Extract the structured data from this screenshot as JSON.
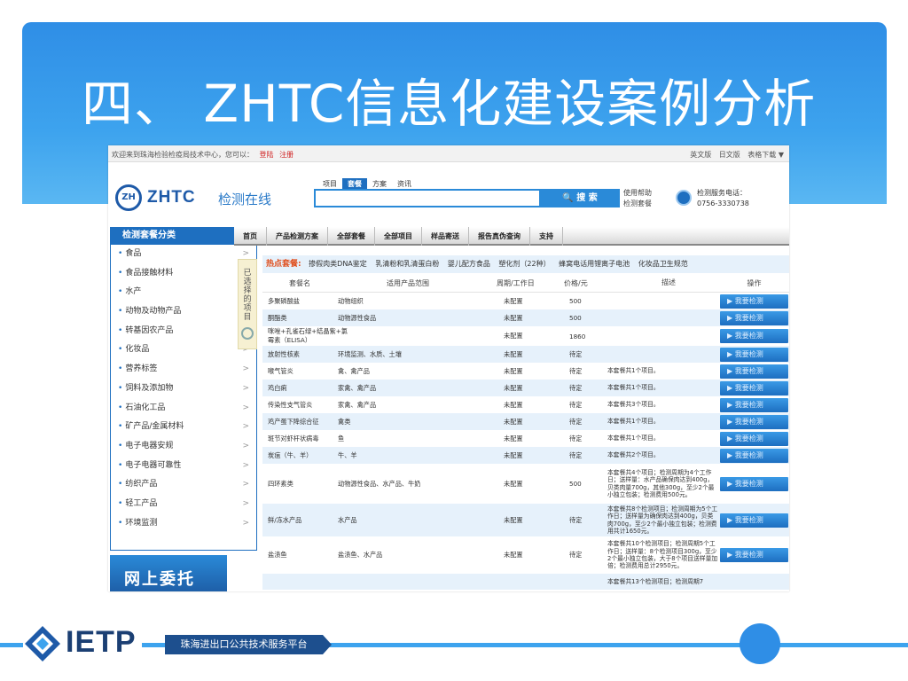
{
  "slide": {
    "title": "四、 ZHTC信息化建设案例分析",
    "footer_logo": "IETP",
    "footer_platform": "珠海进出口公共技术服务平台"
  },
  "colors": {
    "primary": "#2f8ee6",
    "brand_dark": "#1b3f73",
    "button": "#1d6ec0",
    "hot": "#e0501f"
  },
  "site": {
    "topbar": {
      "welcome": "欢迎来到珠海检验检疫局技术中心，您可以：",
      "login": "登陆",
      "register": "注册",
      "right_links": [
        "英文版",
        "日文版",
        "表格下载 ▼"
      ]
    },
    "logo": {
      "mark": "ZH",
      "name": "ZHTC",
      "sub": "检测在线"
    },
    "search": {
      "tabs": [
        "项目",
        "套餐",
        "方案",
        "资讯"
      ],
      "button": "🔍 搜 索",
      "help_1": "使用帮助",
      "help_2": "检测套餐"
    },
    "hotline": {
      "label": "检测服务电话：",
      "number": "0756-3330738"
    },
    "sidebar": {
      "title": "检测套餐分类",
      "items": [
        "食品",
        "食品接触材料",
        "水产",
        "动物及动物产品",
        "转基因农产品",
        "化妆品",
        "营养标签",
        "饲料及添加物",
        "石油化工品",
        "矿产品/金属材料",
        "电子电器安规",
        "电子电器可靠性",
        "纺织产品",
        "轻工产品",
        "环境监测"
      ],
      "arrow": ">"
    },
    "promo": "网上委托",
    "nav": [
      "首页",
      "产品检测方案",
      "全部套餐",
      "全部项目",
      "样品寄送",
      "报告真伪查询",
      "支持"
    ],
    "selected_strip": "已选择的项目",
    "hot": {
      "label": "热点套餐:",
      "tags": [
        "掺假肉类DNA鉴定",
        "乳清粉和乳清蛋白粉",
        "婴儿配方食品",
        "塑化剂（22种）",
        "蜂窝电话用锂离子电池",
        "化妆品卫生规范"
      ]
    },
    "table": {
      "headers": [
        "套餐名",
        "适用产品范围",
        "周期/工作日",
        "价格/元",
        "描述",
        "操作"
      ],
      "button_label": "▶ 我要检测",
      "rows": [
        {
          "name": "多聚磷酸盐",
          "range": "动物组织",
          "cycle": "未配置",
          "price": "500",
          "desc": ""
        },
        {
          "name": "酮酯类",
          "range": "动物源性食品",
          "cycle": "未配置",
          "price": "500",
          "desc": ""
        },
        {
          "name": "咪唑+孔雀石绿+结晶紫+氯霉素（ELISA）",
          "range": "",
          "cycle": "未配置",
          "price": "1860",
          "desc": ""
        },
        {
          "name": "放射性核素",
          "range": "环境监测、水质、土壤",
          "cycle": "未配置",
          "price": "待定",
          "desc": ""
        },
        {
          "name": "喉气管炎",
          "range": "禽、禽产品",
          "cycle": "未配置",
          "price": "待定",
          "desc": "本套餐共1个项目。"
        },
        {
          "name": "鸡白痢",
          "range": "家禽、禽产品",
          "cycle": "未配置",
          "price": "待定",
          "desc": "本套餐共1个项目。"
        },
        {
          "name": "传染性支气管炎",
          "range": "家禽、禽产品",
          "cycle": "未配置",
          "price": "待定",
          "desc": "本套餐共3个项目。"
        },
        {
          "name": "鸡产蛋下降综合征",
          "range": "禽类",
          "cycle": "未配置",
          "price": "待定",
          "desc": "本套餐共1个项目。"
        },
        {
          "name": "斑节对虾杆状病毒",
          "range": "鱼",
          "cycle": "未配置",
          "price": "待定",
          "desc": "本套餐共1个项目。"
        },
        {
          "name": "炭疽（牛、羊）",
          "range": "牛、羊",
          "cycle": "未配置",
          "price": "待定",
          "desc": "本套餐共2个项目。"
        },
        {
          "name": "四环素类",
          "range": "动物源性食品、水产品、牛奶",
          "cycle": "未配置",
          "price": "500",
          "desc": "本套餐共4个项目；检测周期为4个工作日；送样量：水产品确保肉达到400g，贝类肉量700g，其他300g，至少2个最小独立包装；检测费用500元。"
        },
        {
          "name": "鲜/冻水产品",
          "range": "水产品",
          "cycle": "未配置",
          "price": "待定",
          "desc": "本套餐共8个检测项目；检测周期为5个工作日；送样量为确保肉达到400g，贝类肉700g，至少2个最小独立包装；检测费用共计1650元。"
        },
        {
          "name": "盐渍鱼",
          "range": "盐渍鱼、水产品",
          "cycle": "未配置",
          "price": "待定",
          "desc": "本套餐共10个检测项目；检测周期5个工作日；送样量：8个检测项目300g，至少2个最小独立包装，大于8个项目送样量加倍；检测费用总计2950元。"
        },
        {
          "name": "",
          "range": "",
          "cycle": "",
          "price": "",
          "desc": "本套餐共13个检测项目；检测周期7"
        }
      ]
    }
  }
}
